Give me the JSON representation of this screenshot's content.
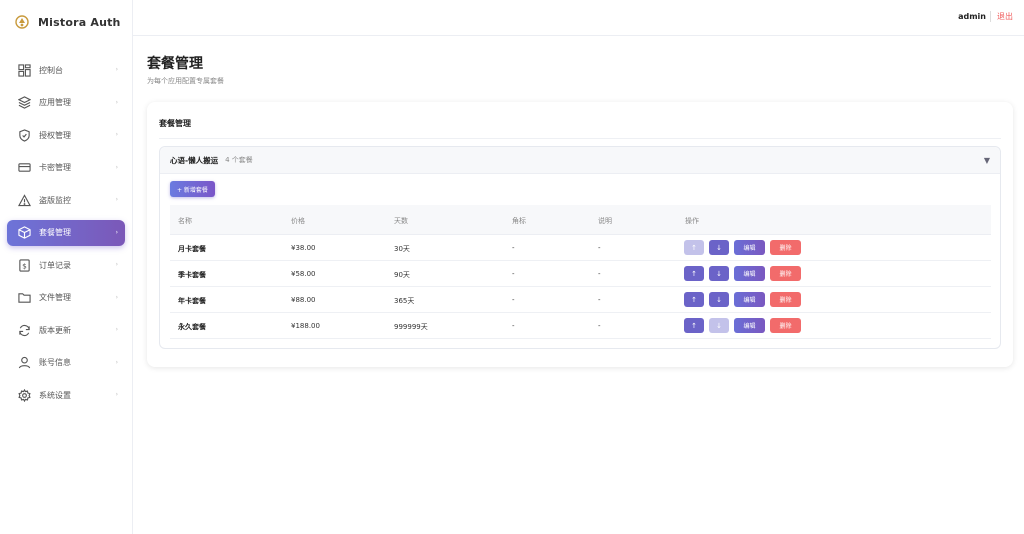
{
  "app": {
    "title": "Mistora Auth"
  },
  "sidebar": {
    "items": [
      {
        "label": "控制台",
        "icon": "dashboard-icon"
      },
      {
        "label": "应用管理",
        "icon": "layers-icon"
      },
      {
        "label": "授权管理",
        "icon": "shield-icon"
      },
      {
        "label": "卡密管理",
        "icon": "card-icon"
      },
      {
        "label": "盗版监控",
        "icon": "warning-icon"
      },
      {
        "label": "套餐管理",
        "icon": "box-icon",
        "active": true
      },
      {
        "label": "订单记录",
        "icon": "receipt-icon"
      },
      {
        "label": "文件管理",
        "icon": "folder-icon"
      },
      {
        "label": "版本更新",
        "icon": "refresh-icon"
      },
      {
        "label": "账号信息",
        "icon": "user-icon"
      },
      {
        "label": "系统设置",
        "icon": "gear-icon"
      }
    ]
  },
  "topbar": {
    "user": "admin",
    "logout": "退出"
  },
  "page": {
    "title": "套餐管理",
    "subtitle": "为每个应用配置专属套餐"
  },
  "card": {
    "title": "套餐管理"
  },
  "group": {
    "name": "心语-懒人搬运",
    "count": "4 个套餐",
    "add_label": "+ 新增套餐"
  },
  "table": {
    "headers": [
      "名称",
      "价格",
      "天数",
      "角标",
      "说明",
      "操作"
    ],
    "rows": [
      {
        "name": "月卡套餐",
        "price": "¥38.00",
        "days": "30天",
        "badge": "-",
        "desc": "-",
        "up_disabled": true,
        "down_disabled": false
      },
      {
        "name": "季卡套餐",
        "price": "¥58.00",
        "days": "90天",
        "badge": "-",
        "desc": "-",
        "up_disabled": false,
        "down_disabled": false
      },
      {
        "name": "年卡套餐",
        "price": "¥88.00",
        "days": "365天",
        "badge": "-",
        "desc": "-",
        "up_disabled": false,
        "down_disabled": false
      },
      {
        "name": "永久套餐",
        "price": "¥188.00",
        "days": "999999天",
        "badge": "-",
        "desc": "-",
        "up_disabled": false,
        "down_disabled": true
      }
    ],
    "actions": {
      "up": "↑",
      "down": "↓",
      "edit": "编辑",
      "delete": "删除"
    }
  }
}
